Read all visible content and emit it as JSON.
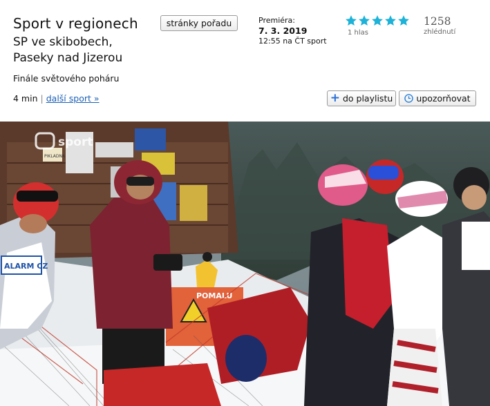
{
  "show": {
    "title": "Sport v regionech",
    "show_page_button": "stránky pořadu"
  },
  "episode": {
    "title_line1": "SP ve skibobech,",
    "title_line2": "Paseky nad Jizerou",
    "subtitle": "Finále světového poháru",
    "duration": "4 min",
    "separator": "|",
    "more_link": "další sport »"
  },
  "premiere": {
    "label": "Premiéra:",
    "date": "7. 3. 2019",
    "time_channel": "12:55 na ČT sport"
  },
  "rating": {
    "stars": 5,
    "max_stars": 5,
    "votes": "1 hlas",
    "star_color": "#1eb2d8"
  },
  "views": {
    "count": "1258",
    "label": "zhlédnutí"
  },
  "actions": {
    "playlist": "do playlistu",
    "notify": "upozorňovat"
  },
  "video": {
    "channel_logo": "sport",
    "banner_text": "POMALU",
    "bib_text": "ALARM CZ",
    "sign_text": "PIKLADNA"
  }
}
